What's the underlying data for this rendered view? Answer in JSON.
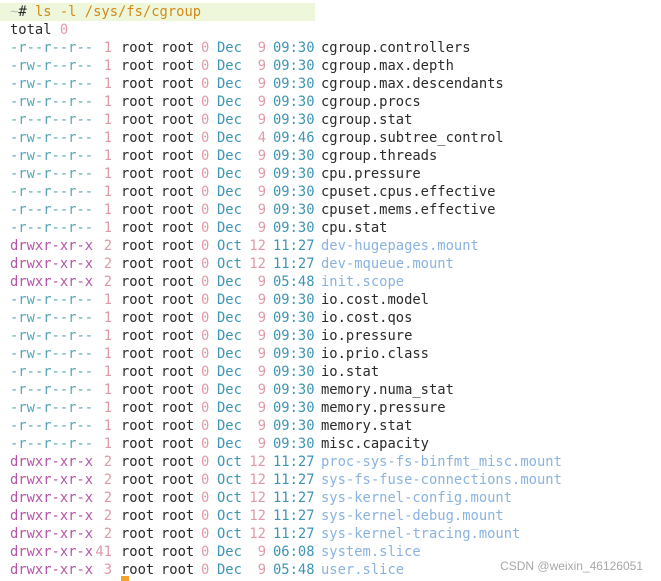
{
  "prompt": {
    "host": "~",
    "symbol": "~# ",
    "command": "ls -l /sys/fs/cgroup"
  },
  "total": {
    "label": "total",
    "value": "0"
  },
  "entries": [
    {
      "perm": "-r--r--r--",
      "links": "1",
      "owner": "root",
      "group": "root",
      "size": "0",
      "month": "Dec",
      "day": "9",
      "time": "09:30",
      "name": "cgroup.controllers",
      "is_dir": false
    },
    {
      "perm": "-rw-r--r--",
      "links": "1",
      "owner": "root",
      "group": "root",
      "size": "0",
      "month": "Dec",
      "day": "9",
      "time": "09:30",
      "name": "cgroup.max.depth",
      "is_dir": false
    },
    {
      "perm": "-rw-r--r--",
      "links": "1",
      "owner": "root",
      "group": "root",
      "size": "0",
      "month": "Dec",
      "day": "9",
      "time": "09:30",
      "name": "cgroup.max.descendants",
      "is_dir": false
    },
    {
      "perm": "-rw-r--r--",
      "links": "1",
      "owner": "root",
      "group": "root",
      "size": "0",
      "month": "Dec",
      "day": "9",
      "time": "09:30",
      "name": "cgroup.procs",
      "is_dir": false
    },
    {
      "perm": "-r--r--r--",
      "links": "1",
      "owner": "root",
      "group": "root",
      "size": "0",
      "month": "Dec",
      "day": "9",
      "time": "09:30",
      "name": "cgroup.stat",
      "is_dir": false
    },
    {
      "perm": "-rw-r--r--",
      "links": "1",
      "owner": "root",
      "group": "root",
      "size": "0",
      "month": "Dec",
      "day": "4",
      "time": "09:46",
      "name": "cgroup.subtree_control",
      "is_dir": false
    },
    {
      "perm": "-rw-r--r--",
      "links": "1",
      "owner": "root",
      "group": "root",
      "size": "0",
      "month": "Dec",
      "day": "9",
      "time": "09:30",
      "name": "cgroup.threads",
      "is_dir": false
    },
    {
      "perm": "-rw-r--r--",
      "links": "1",
      "owner": "root",
      "group": "root",
      "size": "0",
      "month": "Dec",
      "day": "9",
      "time": "09:30",
      "name": "cpu.pressure",
      "is_dir": false
    },
    {
      "perm": "-r--r--r--",
      "links": "1",
      "owner": "root",
      "group": "root",
      "size": "0",
      "month": "Dec",
      "day": "9",
      "time": "09:30",
      "name": "cpuset.cpus.effective",
      "is_dir": false
    },
    {
      "perm": "-r--r--r--",
      "links": "1",
      "owner": "root",
      "group": "root",
      "size": "0",
      "month": "Dec",
      "day": "9",
      "time": "09:30",
      "name": "cpuset.mems.effective",
      "is_dir": false
    },
    {
      "perm": "-r--r--r--",
      "links": "1",
      "owner": "root",
      "group": "root",
      "size": "0",
      "month": "Dec",
      "day": "9",
      "time": "09:30",
      "name": "cpu.stat",
      "is_dir": false
    },
    {
      "perm": "drwxr-xr-x",
      "links": "2",
      "owner": "root",
      "group": "root",
      "size": "0",
      "month": "Oct",
      "day": "12",
      "time": "11:27",
      "name": "dev-hugepages.mount",
      "is_dir": true
    },
    {
      "perm": "drwxr-xr-x",
      "links": "2",
      "owner": "root",
      "group": "root",
      "size": "0",
      "month": "Oct",
      "day": "12",
      "time": "11:27",
      "name": "dev-mqueue.mount",
      "is_dir": true
    },
    {
      "perm": "drwxr-xr-x",
      "links": "2",
      "owner": "root",
      "group": "root",
      "size": "0",
      "month": "Dec",
      "day": "9",
      "time": "05:48",
      "name": "init.scope",
      "is_dir": true
    },
    {
      "perm": "-rw-r--r--",
      "links": "1",
      "owner": "root",
      "group": "root",
      "size": "0",
      "month": "Dec",
      "day": "9",
      "time": "09:30",
      "name": "io.cost.model",
      "is_dir": false
    },
    {
      "perm": "-rw-r--r--",
      "links": "1",
      "owner": "root",
      "group": "root",
      "size": "0",
      "month": "Dec",
      "day": "9",
      "time": "09:30",
      "name": "io.cost.qos",
      "is_dir": false
    },
    {
      "perm": "-rw-r--r--",
      "links": "1",
      "owner": "root",
      "group": "root",
      "size": "0",
      "month": "Dec",
      "day": "9",
      "time": "09:30",
      "name": "io.pressure",
      "is_dir": false
    },
    {
      "perm": "-rw-r--r--",
      "links": "1",
      "owner": "root",
      "group": "root",
      "size": "0",
      "month": "Dec",
      "day": "9",
      "time": "09:30",
      "name": "io.prio.class",
      "is_dir": false
    },
    {
      "perm": "-r--r--r--",
      "links": "1",
      "owner": "root",
      "group": "root",
      "size": "0",
      "month": "Dec",
      "day": "9",
      "time": "09:30",
      "name": "io.stat",
      "is_dir": false
    },
    {
      "perm": "-r--r--r--",
      "links": "1",
      "owner": "root",
      "group": "root",
      "size": "0",
      "month": "Dec",
      "day": "9",
      "time": "09:30",
      "name": "memory.numa_stat",
      "is_dir": false
    },
    {
      "perm": "-rw-r--r--",
      "links": "1",
      "owner": "root",
      "group": "root",
      "size": "0",
      "month": "Dec",
      "day": "9",
      "time": "09:30",
      "name": "memory.pressure",
      "is_dir": false
    },
    {
      "perm": "-r--r--r--",
      "links": "1",
      "owner": "root",
      "group": "root",
      "size": "0",
      "month": "Dec",
      "day": "9",
      "time": "09:30",
      "name": "memory.stat",
      "is_dir": false
    },
    {
      "perm": "-r--r--r--",
      "links": "1",
      "owner": "root",
      "group": "root",
      "size": "0",
      "month": "Dec",
      "day": "9",
      "time": "09:30",
      "name": "misc.capacity",
      "is_dir": false
    },
    {
      "perm": "drwxr-xr-x",
      "links": "2",
      "owner": "root",
      "group": "root",
      "size": "0",
      "month": "Oct",
      "day": "12",
      "time": "11:27",
      "name": "proc-sys-fs-binfmt_misc.mount",
      "is_dir": true
    },
    {
      "perm": "drwxr-xr-x",
      "links": "2",
      "owner": "root",
      "group": "root",
      "size": "0",
      "month": "Oct",
      "day": "12",
      "time": "11:27",
      "name": "sys-fs-fuse-connections.mount",
      "is_dir": true
    },
    {
      "perm": "drwxr-xr-x",
      "links": "2",
      "owner": "root",
      "group": "root",
      "size": "0",
      "month": "Oct",
      "day": "12",
      "time": "11:27",
      "name": "sys-kernel-config.mount",
      "is_dir": true
    },
    {
      "perm": "drwxr-xr-x",
      "links": "2",
      "owner": "root",
      "group": "root",
      "size": "0",
      "month": "Oct",
      "day": "12",
      "time": "11:27",
      "name": "sys-kernel-debug.mount",
      "is_dir": true
    },
    {
      "perm": "drwxr-xr-x",
      "links": "2",
      "owner": "root",
      "group": "root",
      "size": "0",
      "month": "Oct",
      "day": "12",
      "time": "11:27",
      "name": "sys-kernel-tracing.mount",
      "is_dir": true
    },
    {
      "perm": "drwxr-xr-x",
      "links": "41",
      "owner": "root",
      "group": "root",
      "size": "0",
      "month": "Dec",
      "day": "9",
      "time": "06:08",
      "name": "system.slice",
      "is_dir": true
    },
    {
      "perm": "drwxr-xr-x",
      "links": "3",
      "owner": "root",
      "group": "root",
      "size": "0",
      "month": "Dec",
      "day": "9",
      "time": "05:48",
      "name": "user.slice",
      "is_dir": true
    }
  ],
  "watermark": "CSDN @weixin_46126051",
  "colors": {
    "command": "#d08a1a",
    "directory_name": "#8ab3df",
    "cursor": "#f2a22f"
  }
}
